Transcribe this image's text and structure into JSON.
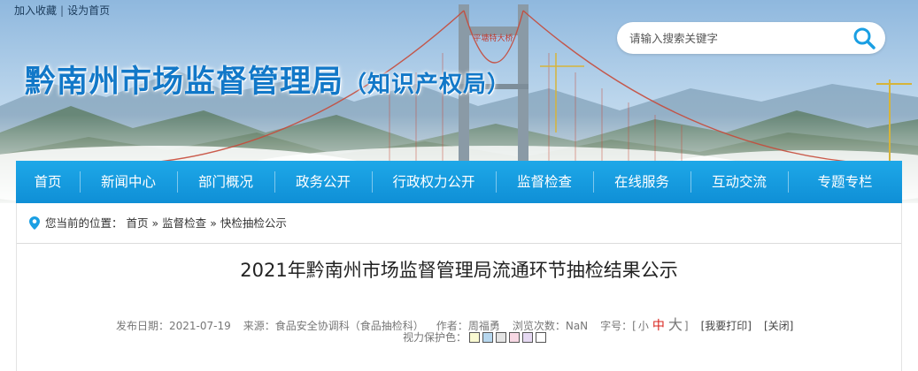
{
  "topbar": {
    "add_favorite": "加入收藏",
    "separator": "|",
    "set_homepage": "设为首页"
  },
  "header": {
    "title": "黔南州市场监督管理局",
    "subtitle": "（知识产权局）",
    "title_color": "#1278c8",
    "bridge_sign": "平塘特大桥"
  },
  "search": {
    "placeholder": "请输入搜索关键字",
    "icon": "search-icon"
  },
  "nav": {
    "color": "#1a9fe3",
    "items": [
      {
        "label": "首页"
      },
      {
        "label": "新闻中心"
      },
      {
        "label": "部门概况"
      },
      {
        "label": "政务公开"
      },
      {
        "label": "行政权力公开"
      },
      {
        "label": "监督检查"
      },
      {
        "label": "在线服务"
      },
      {
        "label": "互动交流"
      },
      {
        "label": "专题专栏"
      }
    ]
  },
  "breadcrumb": {
    "icon": "location-pin-icon",
    "prefix": "您当前的位置：",
    "items": [
      "首页",
      "监督检查",
      "快检抽检公示"
    ],
    "separator": "»"
  },
  "article": {
    "title": "2021年黔南州市场监督管理局流通环节抽检结果公示",
    "publish_label": "发布日期：",
    "publish_date": "2021-07-19",
    "source_label": "来源：",
    "source": "食品安全协调科（食品抽检科）",
    "author_label": "作者：",
    "author": "周福勇",
    "views_label": "浏览次数：",
    "views": "NaN",
    "font_label": "字号：[",
    "font_small": "小",
    "font_medium": "中",
    "font_large": "大",
    "font_close": "]",
    "print": "[我要打印]",
    "close": "[关闭]",
    "protect_label": "视力保护色：",
    "protect_colors": [
      "#fafad2",
      "#b7d7ee",
      "#e4e4e4",
      "#f8d8e4",
      "#e6d9f2",
      "#ffffff"
    ],
    "accent_color": "#d8231c"
  }
}
